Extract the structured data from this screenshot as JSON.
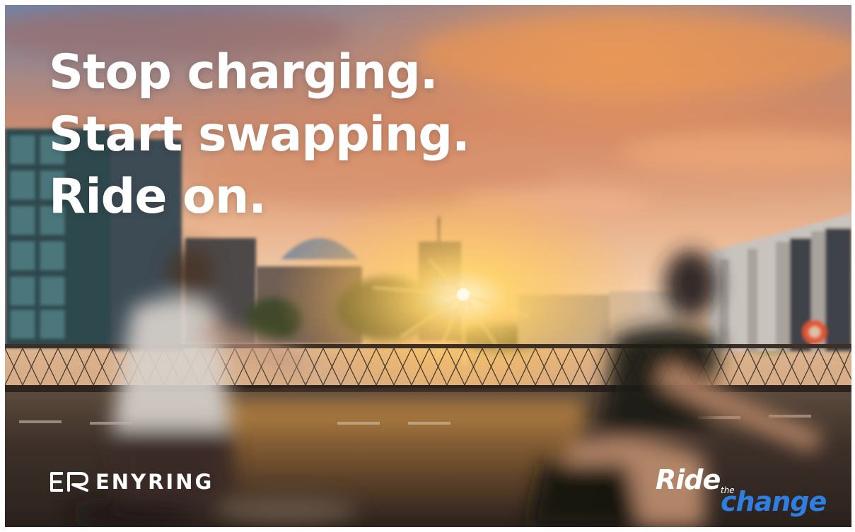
{
  "headline": {
    "line1": "Stop charging.",
    "line2": "Start swapping.",
    "line3": "Ride on."
  },
  "brand": {
    "name": "ENYRING",
    "logo_icon": "er-monogram-icon"
  },
  "slogan": {
    "ride": "Ride",
    "the": "the",
    "change": "change",
    "change_color": "#2f7fe2"
  },
  "background": {
    "scene": "sunset-city-bridge-cyclists"
  }
}
